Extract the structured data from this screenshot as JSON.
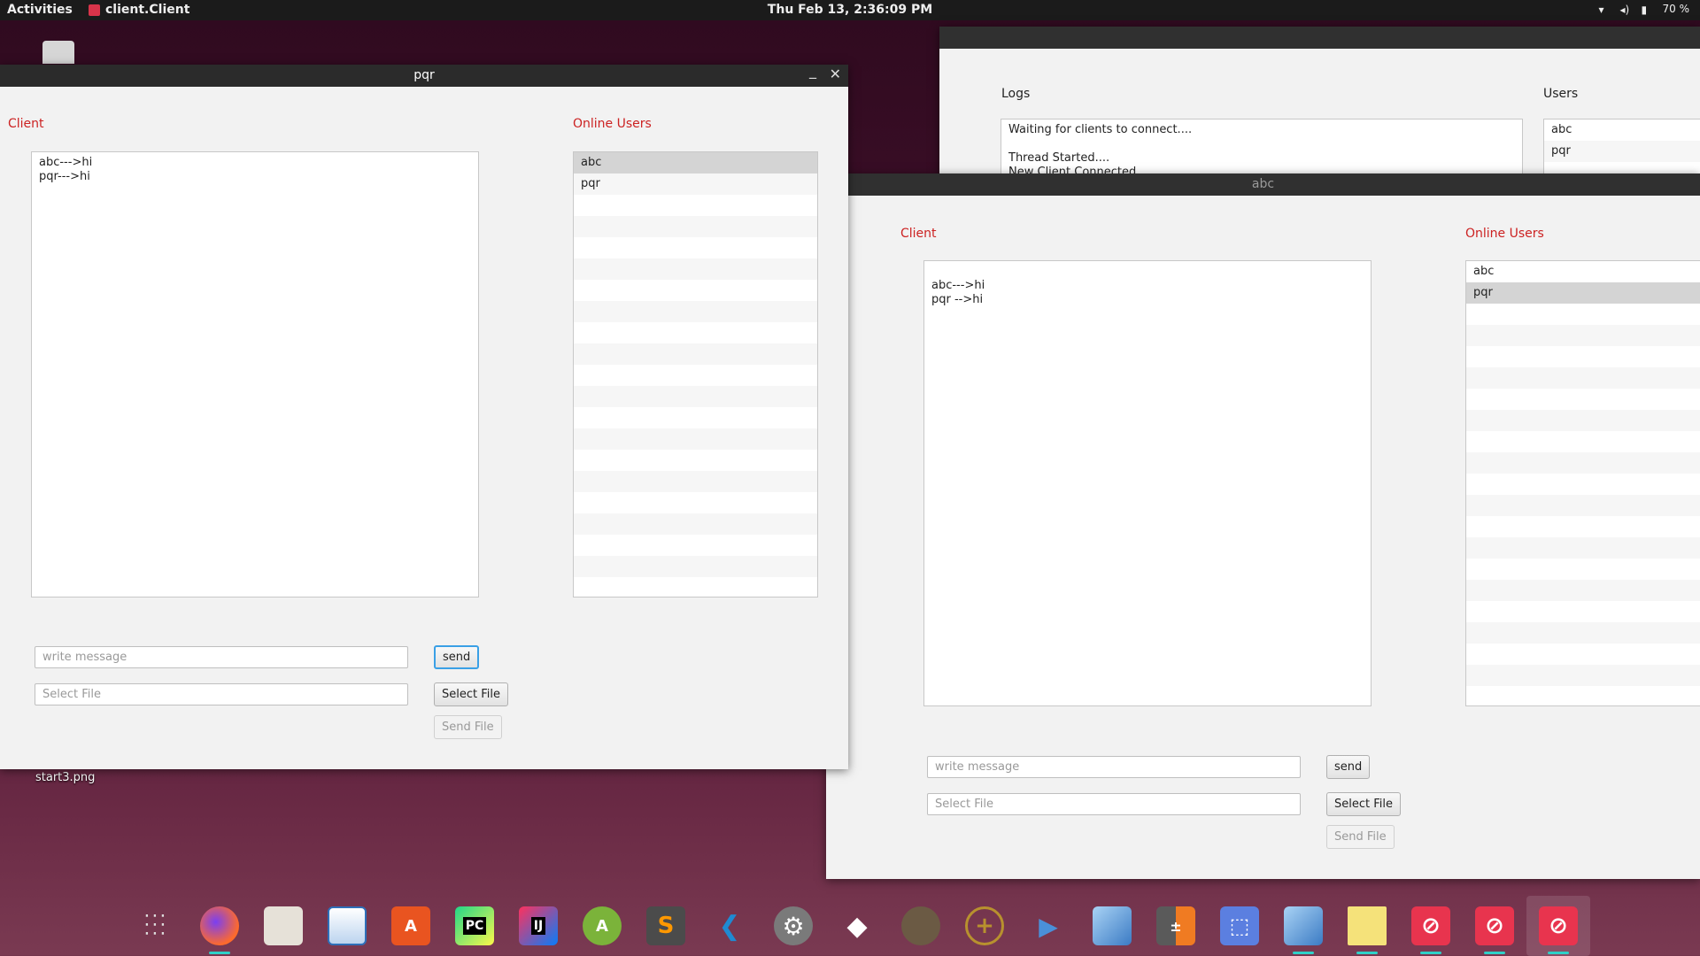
{
  "topbar": {
    "activities": "Activities",
    "app_name": "client.Client",
    "clock": "Thu Feb 13,  2:36:09 PM",
    "battery": "70 %"
  },
  "desktop": {
    "file_label": "start3.png"
  },
  "window_pqr": {
    "title": "pqr",
    "minimize": "_",
    "close": "✕",
    "client_label": "Client",
    "online_users_label": "Online Users",
    "messages": [
      "abc--->hi",
      "pqr--->hi"
    ],
    "users": [
      "abc",
      "pqr"
    ],
    "selected_user": "abc",
    "message_placeholder": "write message",
    "file_placeholder": "Select File",
    "send_label": "send",
    "select_file_label": "Select File",
    "send_file_label": "Send File"
  },
  "server_window": {
    "logs_label": "Logs",
    "users_label": "Users",
    "logs": [
      "Waiting for clients to connect....",
      "",
      "Thread Started....",
      "New Client Connected"
    ],
    "users": [
      "abc",
      "pqr"
    ]
  },
  "window_abc": {
    "title": "abc",
    "client_label": "Client",
    "online_users_label": "Online Users",
    "messages": [
      "abc--->hi",
      "pqr -->hi"
    ],
    "users": [
      "abc",
      "pqr"
    ],
    "selected_user": "pqr",
    "message_placeholder": "write message",
    "file_placeholder": "Select File",
    "send_label": "send",
    "select_file_label": "Select File",
    "send_file_label": "Send File"
  },
  "dock": {
    "items": [
      {
        "name": "show-applications-icon",
        "glyph": "⋮⋮⋮"
      },
      {
        "name": "firefox-icon",
        "glyph": ""
      },
      {
        "name": "files-icon",
        "glyph": ""
      },
      {
        "name": "image-viewer-icon",
        "glyph": ""
      },
      {
        "name": "software-center-icon",
        "glyph": "A"
      },
      {
        "name": "pycharm-icon",
        "glyph": "PC"
      },
      {
        "name": "intellij-icon",
        "glyph": "IJ"
      },
      {
        "name": "android-studio-icon",
        "glyph": "A"
      },
      {
        "name": "sublime-text-icon",
        "glyph": "S"
      },
      {
        "name": "vscode-icon",
        "glyph": "❮❯"
      },
      {
        "name": "settings-icon",
        "glyph": "⚙"
      },
      {
        "name": "unity-icon",
        "glyph": "◆"
      },
      {
        "name": "gimp-icon",
        "glyph": ""
      },
      {
        "name": "compass-icon",
        "glyph": "⊕"
      },
      {
        "name": "audio-editor-icon",
        "glyph": "▶"
      },
      {
        "name": "virtualbox-icon",
        "glyph": ""
      },
      {
        "name": "calculator-icon",
        "glyph": "±"
      },
      {
        "name": "screenshot-icon",
        "glyph": "⬚"
      },
      {
        "name": "virtualbox-2-icon",
        "glyph": ""
      },
      {
        "name": "sticky-notes-icon",
        "glyph": ""
      },
      {
        "name": "blocked-app-1-icon",
        "glyph": "⊘"
      },
      {
        "name": "blocked-app-2-icon",
        "glyph": "⊘"
      },
      {
        "name": "blocked-app-3-icon",
        "glyph": "⊘"
      }
    ]
  },
  "colors": {
    "accent_red": "#cc2222",
    "titlebar": "#2b2b2b",
    "focus_blue": "#3aa0e6"
  }
}
